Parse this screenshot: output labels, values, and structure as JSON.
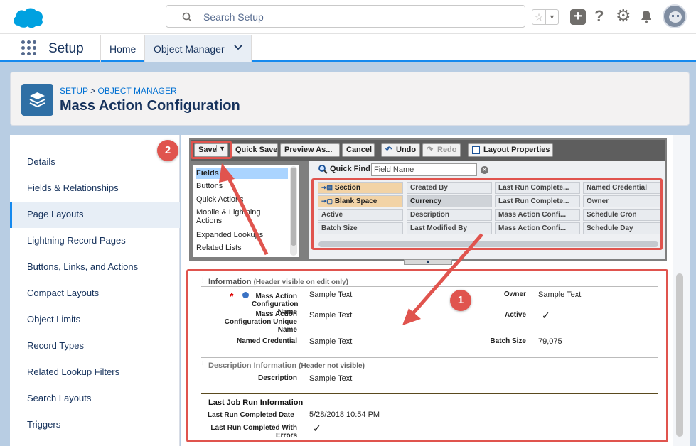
{
  "search": {
    "placeholder": "Search Setup"
  },
  "nav": {
    "app_name": "Setup",
    "tabs": [
      "Home",
      "Object Manager"
    ]
  },
  "header": {
    "breadcrumb_1": "SETUP",
    "breadcrumb_sep": ">",
    "breadcrumb_2": "OBJECT MANAGER",
    "title": "Mass Action Configuration"
  },
  "sidebar": {
    "items": [
      "Details",
      "Fields & Relationships",
      "Page Layouts",
      "Lightning Record Pages",
      "Buttons, Links, and Actions",
      "Compact Layouts",
      "Object Limits",
      "Record Types",
      "Related Lookup Filters",
      "Search Layouts",
      "Triggers"
    ],
    "active": "Page Layouts"
  },
  "toolbar": {
    "save": "Save",
    "quick_save": "Quick Save",
    "preview": "Preview As...",
    "cancel": "Cancel",
    "undo": "Undo",
    "redo": "Redo",
    "layout_props": "Layout Properties"
  },
  "palette": {
    "categories": [
      "Fields",
      "Buttons",
      "Quick Actions",
      "Mobile & Lightning Actions",
      "Expanded Lookups",
      "Related Lists"
    ],
    "quick_find_label": "Quick Find",
    "quick_find_value": "Field Name",
    "fields": [
      [
        "Section",
        "Created By",
        "Last Run Complete...",
        "Named Credential"
      ],
      [
        "Blank Space",
        "Currency",
        "Last Run Complete...",
        "Owner"
      ],
      [
        "Active",
        "Description",
        "Mass Action Confi...",
        "Schedule Cron"
      ],
      [
        "Batch Size",
        "Last Modified By",
        "Mass Action Confi...",
        "Schedule Day"
      ]
    ]
  },
  "layout": {
    "sec1_title": "Information",
    "sec1_note": "(Header visible on edit only)",
    "f1_label": "Mass Action Configuration Name",
    "f1_value": "Sample Text",
    "f2_label": "Mass Action Configuration Unique Name",
    "f2_value": "Sample Text",
    "f3_label": "Named Credential",
    "f3_value": "Sample Text",
    "r1_label": "Owner",
    "r1_value": "Sample Text",
    "r2_label": "Active",
    "r2_value": "✓",
    "r3_label": "Batch Size",
    "r3_value": "79,075",
    "sec2_title": "Description Information",
    "sec2_note": "(Header not visible)",
    "d1_label": "Description",
    "d1_value": "Sample Text",
    "sec3_title": "Last Job Run Information",
    "j1_label": "Last Run Completed Date",
    "j1_value": "5/28/2018 10:54 PM",
    "j2_label": "Last Run Completed With Errors",
    "j2_value": "✓"
  },
  "callouts": {
    "one": "1",
    "two": "2"
  }
}
